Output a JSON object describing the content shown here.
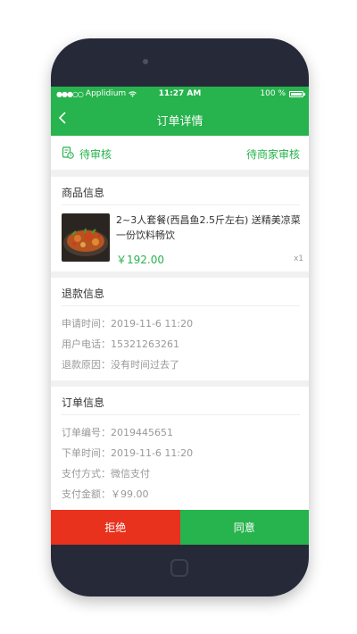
{
  "status_bar": {
    "carrier": "Applidium",
    "time": "11:27 AM",
    "battery": "100 %"
  },
  "nav": {
    "title": "订单详情"
  },
  "order_status": {
    "left": "待审核",
    "right": "待商家审核"
  },
  "product": {
    "section_title": "商品信息",
    "name": "2~3人套餐(西昌鱼2.5斤左右) 送精美凉菜一份饮料畅饮",
    "price": "￥192.00",
    "qty": "x1"
  },
  "refund": {
    "section_title": "退款信息",
    "rows": [
      {
        "label": "申请时间：",
        "value": "2019-11-6 11:20"
      },
      {
        "label": "用户电话：",
        "value": "15321263261"
      },
      {
        "label": "退款原因：",
        "value": "没有时间过去了"
      }
    ]
  },
  "order": {
    "section_title": "订单信息",
    "rows": [
      {
        "label": "订单编号：",
        "value": "2019445651"
      },
      {
        "label": "下单时间：",
        "value": "2019-11-6 11:20"
      },
      {
        "label": "支付方式：",
        "value": "微信支付"
      },
      {
        "label": "支付金额：",
        "value": "￥99.00"
      }
    ]
  },
  "actions": {
    "reject": "拒绝",
    "agree": "同意"
  },
  "colors": {
    "accent": "#27b34d",
    "reject": "#e8321d"
  }
}
